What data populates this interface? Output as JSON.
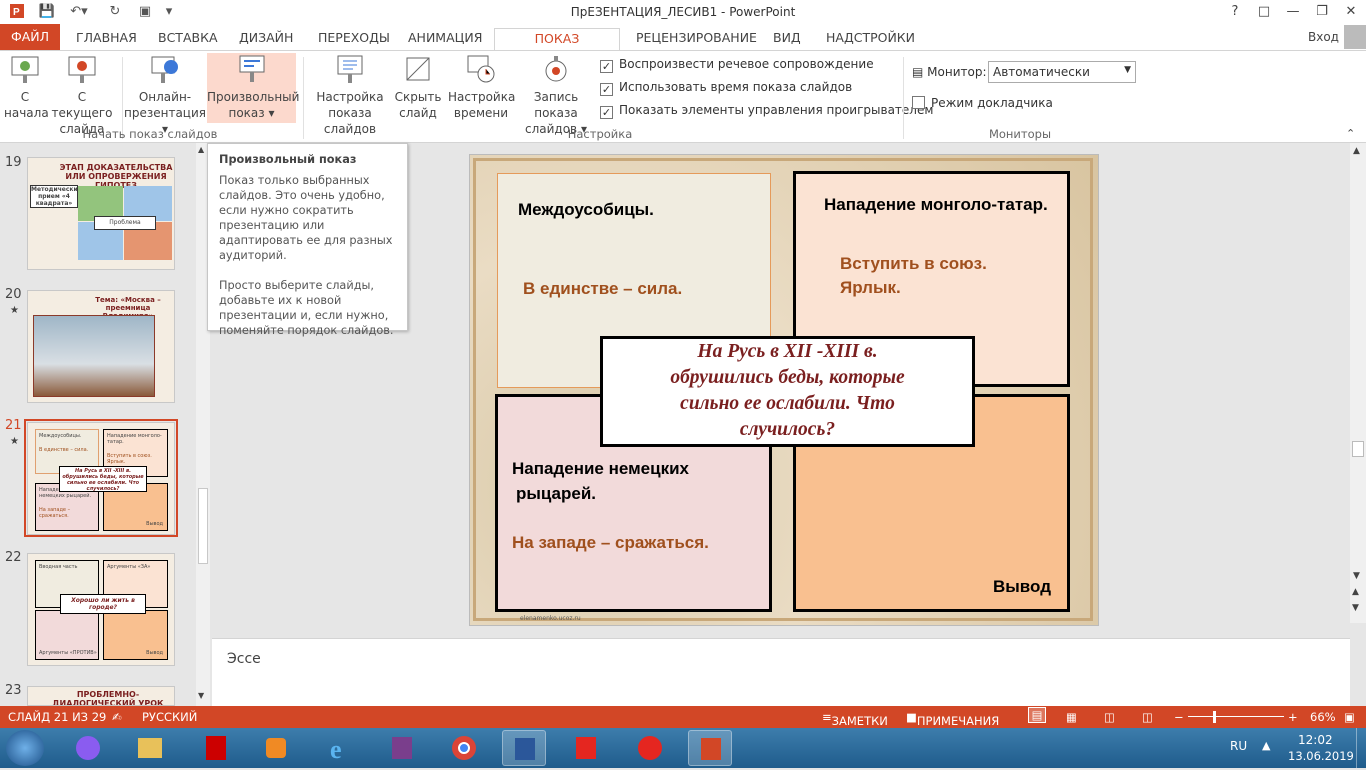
{
  "window": {
    "title": "ПрЕЗЕНТАЦИЯ_ЛЕСИВ1 - PowerPoint",
    "signin": "Вход"
  },
  "tabs": [
    "ФАЙЛ",
    "ГЛАВНАЯ",
    "ВСТАВКА",
    "ДИЗАЙН",
    "ПЕРЕХОДЫ",
    "АНИМАЦИЯ",
    "ПОКАЗ СЛАЙДОВ",
    "РЕЦЕНЗИРОВАНИЕ",
    "ВИД",
    "НАДСТРОЙКИ"
  ],
  "ribbon": {
    "from_start": [
      "С",
      "начала"
    ],
    "from_current": [
      "С текущего",
      "слайда"
    ],
    "online": [
      "Онлайн-",
      "презентация"
    ],
    "custom": [
      "Произвольный",
      "показ"
    ],
    "group_start": "Начать показ слайдов",
    "setup": [
      "Настройка",
      "показа слайдов"
    ],
    "hide": [
      "Скрыть",
      "слайд"
    ],
    "rehearse": [
      "Настройка",
      "времени"
    ],
    "record": [
      "Запись показа",
      "слайдов"
    ],
    "chk_narration": "Воспроизвести речевое сопровождение",
    "chk_timings": "Использовать время показа слайдов",
    "chk_controls": "Показать элементы управления проигрывателем",
    "group_setup": "Настройка",
    "monitor_label": "Монитор:",
    "monitor_value": "Автоматически",
    "presenter": "Режим докладчика",
    "group_monitors": "Мониторы"
  },
  "tooltip": {
    "title": "Произвольный показ",
    "p1": "Показ только выбранных слайдов. Это очень удобно, если нужно сократить презентацию или адаптировать ее для разных аудиторий.",
    "p2": "Просто выберите слайды, добавьте их к новой презентации и, если нужно, поменяйте порядок слайдов."
  },
  "thumbs": [
    {
      "num": "19",
      "title": "ЭТАП ДОКАЗАТЕЛЬСТВА ИЛИ ОПРОВЕРЖЕНИЯ ГИПОТЕЗ",
      "sub": "Методический прием «4 квадрата»",
      "center": "Проблема"
    },
    {
      "num": "20",
      "title": "Тема: «Москва – преемница Владимира»"
    },
    {
      "num": "21",
      "q": "На Русь в XII -XIII в. обрушились беды, которые сильно ее ослабили. Что случилось?",
      "a": "Междоусобицы.",
      "b": "Нападение монголо-татар.",
      "c": "Нападение немецких рыцарей.",
      "d": "Вывод",
      "a2": "В единстве – сила.",
      "b2": "Вступить в союз. Ярлык.",
      "c2": "На западе – сражаться."
    },
    {
      "num": "22",
      "a": "Вводная часть",
      "b": "Аргументы «ЗА»",
      "c": "Аргументы «ПРОТИВ»",
      "d": "Вывод",
      "q": "Хорошо ли жить в городе?"
    },
    {
      "num": "23",
      "title": "ПРОБЛЕМНО-ДИАЛОГИЧЕСКИЙ УРОК"
    }
  ],
  "slide": {
    "q1_title": "Междоусобицы.",
    "q1_text": "В единстве – сила.",
    "q2_title": "Нападение монголо-татар.",
    "q2_text1": "Вступить в союз.",
    "q2_text2": "Ярлык.",
    "q3_title1": "Нападение немецких",
    "q3_title2": "рыцарей.",
    "q3_text": "На западе – сражаться.",
    "q4_title": "Вывод",
    "center1": "На Русь в XII -XIII в.",
    "center2": "обрушились беды, которые",
    "center3": "сильно ее ослабили. Что",
    "center4": "случилось?",
    "footer": "elenamenko.ucoz.ru"
  },
  "notes": "Эссе",
  "status": {
    "slide": "СЛАЙД 21 ИЗ 29",
    "lang": "РУССКИЙ",
    "notes": "ЗАМЕТКИ",
    "comments": "ПРИМЕЧАНИЯ",
    "zoom": "66%"
  },
  "tray": {
    "lang": "RU",
    "time": "12:02",
    "date": "13.06.2019"
  },
  "colors": {
    "accent": "#d24726",
    "brown_text": "#a0501e",
    "quad_peach": "#f9c090",
    "quad_pink": "#f2dada",
    "center_text": "#7a1f1f"
  }
}
